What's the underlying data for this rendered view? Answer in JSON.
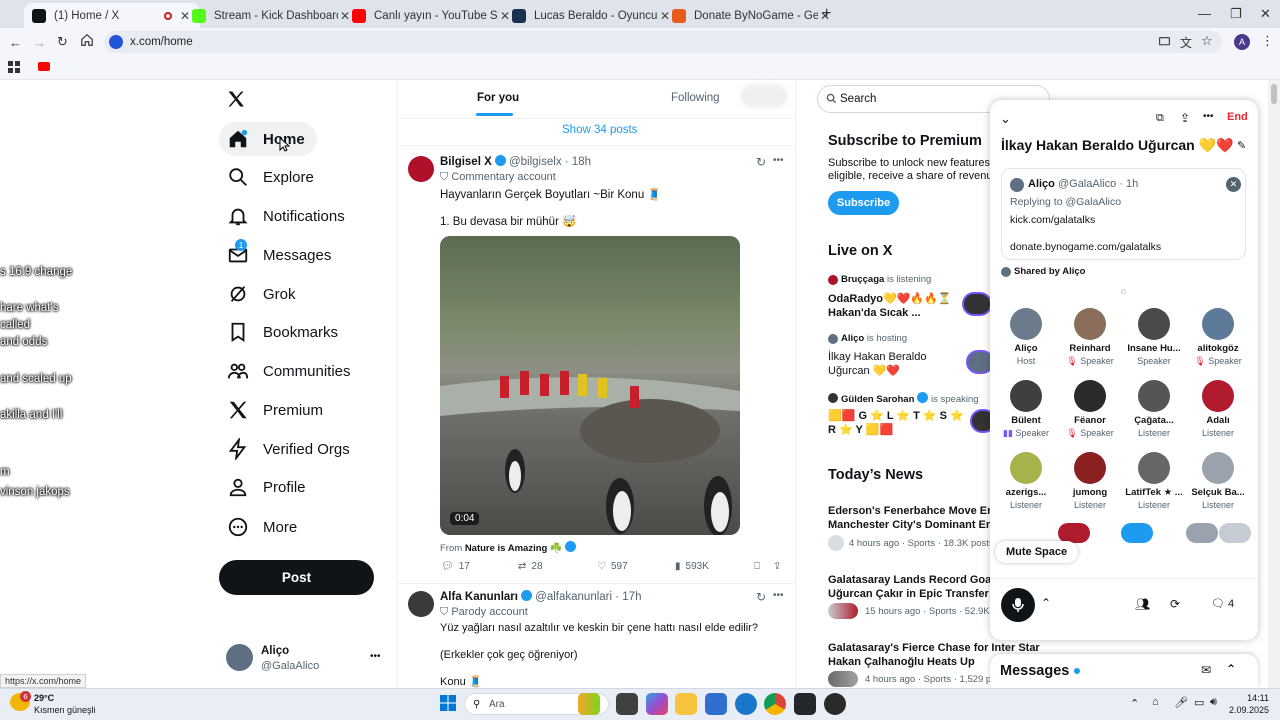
{
  "browser": {
    "tabs": [
      {
        "title": "(1) Home / X",
        "favicon": "x-logo-icon",
        "active": true
      },
      {
        "title": "Stream - Kick Dashboard",
        "favicon": "kick-icon"
      },
      {
        "title": "Canlı yayın - YouTube Studio",
        "favicon": "youtube-icon"
      },
      {
        "title": "Lucas Beraldo - Oyuncu profili",
        "favicon": "transfermarkt-icon"
      },
      {
        "title": "Donate ByNoGame - Gelen/Gi",
        "favicon": "bynogame-icon"
      }
    ],
    "address": "x.com/home",
    "profile_initial": "A",
    "status_url": "https://x.com/home"
  },
  "left_bleed_text": [
    "s 16:9 change",
    "hare what's",
    "called",
    "and odds",
    "and scaled up",
    "akilla and I'll",
    "m",
    "vinson jakops"
  ],
  "nav": {
    "items": [
      {
        "label": "Home",
        "icon": "home-icon"
      },
      {
        "label": "Explore",
        "icon": "search-icon"
      },
      {
        "label": "Notifications",
        "icon": "bell-icon"
      },
      {
        "label": "Messages",
        "icon": "mail-icon",
        "badge": "1"
      },
      {
        "label": "Grok",
        "icon": "grok-icon"
      },
      {
        "label": "Bookmarks",
        "icon": "bookmark-icon"
      },
      {
        "label": "Communities",
        "icon": "communities-icon"
      },
      {
        "label": "Premium",
        "icon": "x-logo-icon"
      },
      {
        "label": "Verified Orgs",
        "icon": "lightning-icon"
      },
      {
        "label": "Profile",
        "icon": "person-icon"
      },
      {
        "label": "More",
        "icon": "more-circle-icon"
      }
    ],
    "post_label": "Post",
    "account": {
      "name": "Aliço",
      "handle": "@GalaAlico",
      "more": "•••"
    }
  },
  "feed": {
    "tabs": [
      "For you",
      "Following"
    ],
    "show_posts": "Show 34 posts",
    "posts": [
      {
        "name": "Bilgisel X",
        "handle": "@bilgiselx",
        "time": "· 18h",
        "label": "Commentary account",
        "text1": "Hayvanların Gerçek Boyutları ~Bir Konu 🧵",
        "text2": "1. Bu devasa bir mühür 🤯",
        "video_time": "0:04",
        "from_prefix": "From",
        "from_name": "Nature is Amazing ☘️",
        "replies": "17",
        "reposts": "28",
        "likes": "597",
        "views": "593K"
      },
      {
        "name": "Alfa Kanunları",
        "handle": "@alfakanunlari",
        "time": "· 17h",
        "label": "Parody account",
        "text1": "Yüz yağları nasıl azaltılır ve keskin bir çene hattı nasıl elde edilir?",
        "text2": "(Erkekler çok geç öğreniyor)",
        "text3": "Konu 🧵"
      }
    ]
  },
  "sidebar": {
    "search_placeholder": "Search",
    "premium_title": "Subscribe to Premium",
    "premium_text1": "Subscribe to unlock new features and",
    "premium_text2": "eligible, receive a share of revenue.",
    "subscribe_label": "Subscribe",
    "live_title": "Live on X",
    "live": [
      {
        "host": "Bruççaga",
        "status": "is listening",
        "title1": "OdaRadyo💛❤️🔥🔥⏳",
        "title2": "Hakan'da Sıcak ..."
      },
      {
        "host": "Aliço",
        "status": "is hosting",
        "title1": "İlkay Hakan Beraldo",
        "title2": "Uğurcan 💛❤️"
      },
      {
        "host": "Gülden Sarohan",
        "status": "is speaking",
        "title1": "🟨🟥 G ⭐ L ⭐ T ⭐ S ⭐",
        "title2": "R ⭐ Y 🟨🟥"
      }
    ],
    "news_title": "Today’s News",
    "news": [
      {
        "title1": "Ederson's Fenerbahce Move Ends",
        "title2": "Manchester City's Dominant Era",
        "meta": "4 hours ago · Sports · 18.3K posts"
      },
      {
        "title1": "Galatasaray Lands Record Goalke",
        "title2": "Uğurcan Çakır in Epic Transfer",
        "meta": "15 hours ago · Sports · 52.9K po"
      },
      {
        "title1": "Galatasaray's Fierce Chase for Inter Star",
        "title2": "Hakan Çalhanoğlu Heats Up",
        "meta": "4 hours ago · Sports · 1,529 pos"
      }
    ]
  },
  "space": {
    "end_label": "End",
    "title": "İlkay Hakan Beraldo Uğurcan 💛❤️",
    "pinned": {
      "name": "Aliço",
      "handle": "@GalaAlico",
      "time": "· 1h",
      "replying": "Replying to @GalaAlico",
      "line1": "kick.com/galatalks",
      "line2": "donate.bynogame.com/galatalks"
    },
    "shared_by": "Shared by Aliço",
    "speakers": [
      {
        "name": "Aliço",
        "role": "Host",
        "color": "#6b7b8c"
      },
      {
        "name": "Reinhard",
        "role": "Speaker",
        "color": "#8a6d5a",
        "verified": true,
        "muted": true
      },
      {
        "name": "Insane Hu...",
        "role": "Speaker",
        "color": "#4a4a4a"
      },
      {
        "name": "alitokgöz",
        "role": "Speaker",
        "color": "#5d7a99",
        "muted": true
      },
      {
        "name": "Bülent",
        "role": "Speaker",
        "color": "#3f3f3f",
        "speaking": true
      },
      {
        "name": "Fëanor",
        "role": "Speaker",
        "color": "#2b2b2b",
        "muted": true
      },
      {
        "name": "Çağata...",
        "role": "Listener",
        "color": "#555555",
        "verified": true
      },
      {
        "name": "Adalı",
        "role": "Listener",
        "color": "#b01c2e"
      },
      {
        "name": "azerigs...",
        "role": "Listener",
        "color": "#a8b24a",
        "verified": true
      },
      {
        "name": "jumong",
        "role": "Listener",
        "color": "#8a2020"
      },
      {
        "name": "LatifTek ★ ...",
        "role": "Listener",
        "color": "#666666"
      },
      {
        "name": "Selçuk Ba...",
        "role": "Listener",
        "color": "#9aa3ad"
      }
    ],
    "mute_label": "Mute Space",
    "reply_count": "4"
  },
  "messages_drawer": {
    "label": "Messages"
  },
  "taskbar": {
    "weather_temp": "29°C",
    "weather_desc": "Kısmen güneşli",
    "weather_badge": "6",
    "search_placeholder": "Ara",
    "time": "14:11",
    "date": "2.09.2025"
  }
}
